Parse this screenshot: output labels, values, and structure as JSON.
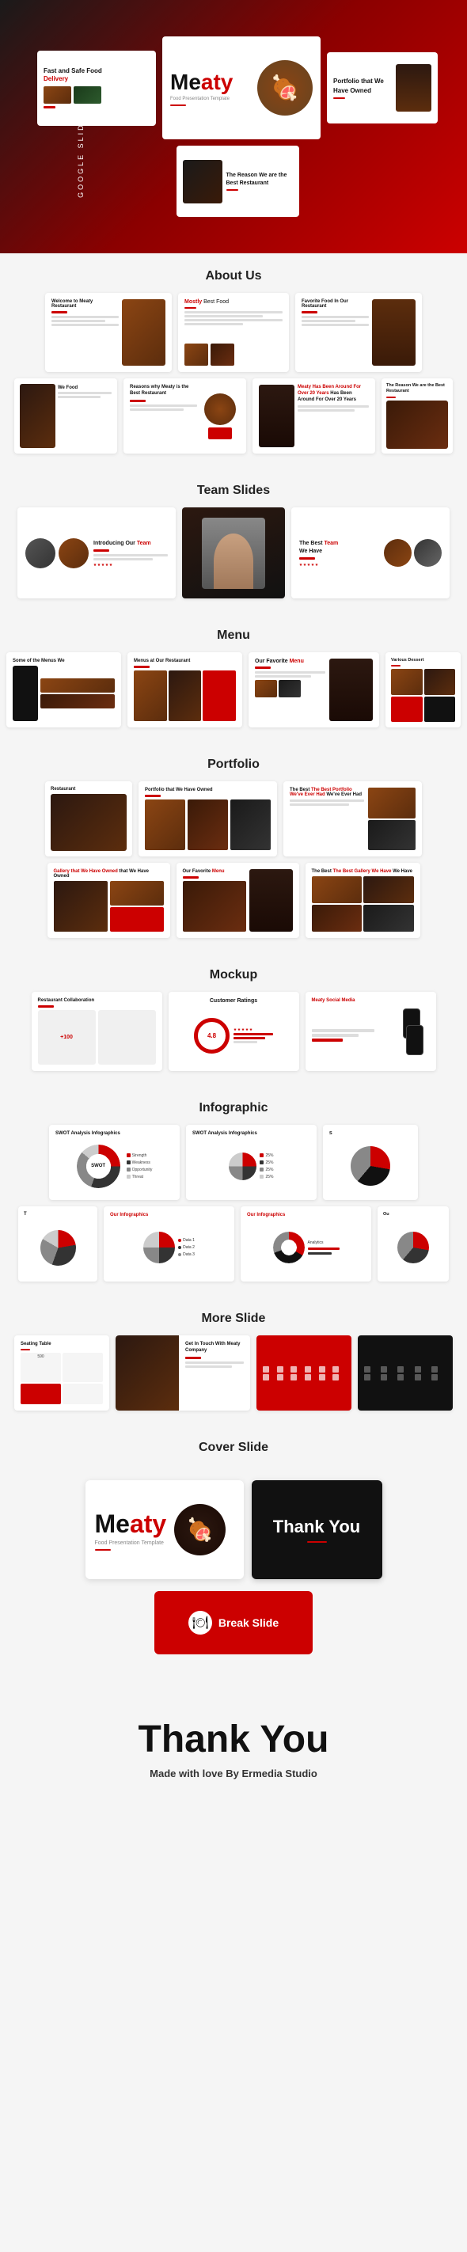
{
  "sidebar": {
    "text": "GOOGLE SLIDE TEMPLATE"
  },
  "hero": {
    "main_slide": {
      "brand": "Meaty",
      "brand_prefix": "Me",
      "brand_suffix": "aty",
      "subtitle": "Food Presentation Template"
    },
    "slides": [
      {
        "title": "Fast and Safe Food",
        "title_accent": "Delivery"
      },
      {
        "title": "Portfolio that We Have Owned"
      },
      {
        "title": "The Reason We are the Best Restaurant"
      }
    ]
  },
  "sections": {
    "about_us": {
      "label": "About Us",
      "slides": [
        {
          "title": "Welcome to Meaty Restaurant"
        },
        {
          "title": "Mostly",
          "subtitle": "Best Food"
        },
        {
          "title": "Favorite Food In Our Restaurant"
        },
        {
          "title": "We Food"
        },
        {
          "title": "Reasons why Meaty is the Best Restaurant"
        },
        {
          "title": "Meaty Has Been Around For Over 20 Years"
        },
        {
          "title": "The Reason We are the Best Restaurant"
        }
      ]
    },
    "team": {
      "label": "Team Slides",
      "slides": [
        {
          "title": "Introducing Our",
          "accent": "Team"
        },
        {
          "title": "The Best",
          "accent": "Team",
          "subtitle": "We Have"
        }
      ]
    },
    "menu": {
      "label": "Menu",
      "slides": [
        {
          "title": "Some of the Menus We"
        },
        {
          "title": "Menus at Our Restaurant"
        },
        {
          "title": "Our Favorite",
          "accent": "Menu"
        },
        {
          "title": "Various Dessert"
        }
      ]
    },
    "portfolio": {
      "label": "Portfolio",
      "slides": [
        {
          "title": "Restaurant"
        },
        {
          "title": "Portfolio that We Have Owned"
        },
        {
          "title": "The Best Portfolio We've Ever Had"
        },
        {
          "title": "Gallery that We Have Owned"
        },
        {
          "title": "Our Favorite",
          "accent": "Menu"
        },
        {
          "title": "The Best Gallery We Have"
        }
      ]
    },
    "mockup": {
      "label": "Mockup",
      "slides": [
        {
          "title": "Restaurant Collaboration"
        },
        {
          "title": "Customer Ratings"
        },
        {
          "title": "Meaty Social Media"
        }
      ]
    },
    "infographic": {
      "label": "Infographic",
      "slides": [
        {
          "title": "SWOT Analysis Infographics"
        },
        {
          "title": "SWOT Analysis Infographics"
        },
        {
          "title": ""
        },
        {
          "title": "Our Infographics"
        },
        {
          "title": "Our Infographics"
        },
        {
          "title": ""
        }
      ]
    },
    "more_slide": {
      "label": "More Slide",
      "slides": [
        {
          "title": "Seating Table"
        },
        {
          "title": "Get In Touch With Meaty Company"
        },
        {
          "title": ""
        },
        {
          "title": ""
        }
      ]
    },
    "cover_slide": {
      "label": "Cover Slide",
      "slides": [
        {
          "title_prefix": "Me",
          "title_suffix": "aty"
        },
        {
          "title": "Thank You"
        }
      ]
    }
  },
  "break_slide": {
    "label": "Break Slide",
    "icon": "🍽"
  },
  "final": {
    "title": "Thank You",
    "subtitle": "Made with love",
    "by": "By Ermedia Studio"
  }
}
